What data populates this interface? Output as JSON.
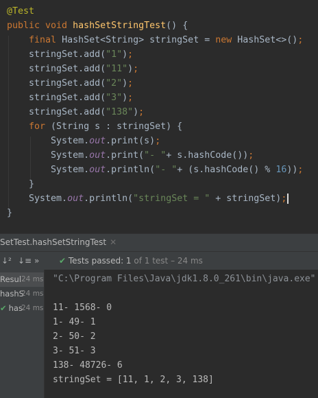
{
  "editor": {
    "lines": [
      {
        "segments": [
          {
            "t": "@Test",
            "c": "ann"
          }
        ]
      },
      {
        "segments": [
          {
            "t": "public void ",
            "c": "kw"
          },
          {
            "t": "hashSetStringTest",
            "c": "fn"
          },
          {
            "t": "() {",
            "c": ""
          }
        ]
      },
      {
        "segments": [
          {
            "t": "    final ",
            "c": "kw"
          },
          {
            "t": "HashSet<String> stringSet = ",
            "c": ""
          },
          {
            "t": "new ",
            "c": "kw"
          },
          {
            "t": "HashSet<>()",
            "c": ""
          },
          {
            "t": ";",
            "c": "kw"
          }
        ]
      },
      {
        "segments": [
          {
            "t": "    stringSet.add(",
            "c": ""
          },
          {
            "t": "\"1\"",
            "c": "str"
          },
          {
            "t": ")",
            "c": ""
          },
          {
            "t": ";",
            "c": "kw"
          }
        ]
      },
      {
        "segments": [
          {
            "t": "    stringSet.add(",
            "c": ""
          },
          {
            "t": "\"11\"",
            "c": "str"
          },
          {
            "t": ")",
            "c": ""
          },
          {
            "t": ";",
            "c": "kw"
          }
        ]
      },
      {
        "segments": [
          {
            "t": "    stringSet.add(",
            "c": ""
          },
          {
            "t": "\"2\"",
            "c": "str"
          },
          {
            "t": ")",
            "c": ""
          },
          {
            "t": ";",
            "c": "kw"
          }
        ]
      },
      {
        "segments": [
          {
            "t": "    stringSet.add(",
            "c": ""
          },
          {
            "t": "\"3\"",
            "c": "str"
          },
          {
            "t": ")",
            "c": ""
          },
          {
            "t": ";",
            "c": "kw"
          }
        ]
      },
      {
        "segments": [
          {
            "t": "    stringSet.add(",
            "c": ""
          },
          {
            "t": "\"138\"",
            "c": "str"
          },
          {
            "t": ")",
            "c": ""
          },
          {
            "t": ";",
            "c": "kw"
          }
        ]
      },
      {
        "segments": [
          {
            "t": "    for ",
            "c": "kw"
          },
          {
            "t": "(String s : stringSet) {",
            "c": ""
          }
        ]
      },
      {
        "segments": [
          {
            "t": "        System.",
            "c": ""
          },
          {
            "t": "out",
            "c": "fld"
          },
          {
            "t": ".print(s)",
            "c": ""
          },
          {
            "t": ";",
            "c": "kw"
          }
        ]
      },
      {
        "segments": [
          {
            "t": "        System.",
            "c": ""
          },
          {
            "t": "out",
            "c": "fld"
          },
          {
            "t": ".print(",
            "c": ""
          },
          {
            "t": "\"- \"",
            "c": "str"
          },
          {
            "t": "+ s.hashCode())",
            "c": ""
          },
          {
            "t": ";",
            "c": "kw"
          }
        ]
      },
      {
        "segments": [
          {
            "t": "        System.",
            "c": ""
          },
          {
            "t": "out",
            "c": "fld"
          },
          {
            "t": ".println(",
            "c": ""
          },
          {
            "t": "\"- \"",
            "c": "str"
          },
          {
            "t": "+ (s.hashCode() % ",
            "c": ""
          },
          {
            "t": "16",
            "c": "num"
          },
          {
            "t": "))",
            "c": ""
          },
          {
            "t": ";",
            "c": "kw"
          }
        ]
      },
      {
        "segments": [
          {
            "t": "    }",
            "c": ""
          }
        ]
      },
      {
        "segments": [
          {
            "t": "    System.",
            "c": ""
          },
          {
            "t": "out",
            "c": "fld"
          },
          {
            "t": ".println(",
            "c": ""
          },
          {
            "t": "\"stringSet = \"",
            "c": "str"
          },
          {
            "t": " + stringSet)",
            "c": ""
          },
          {
            "t": ";",
            "c": "kw"
          }
        ],
        "cursor": true
      },
      {
        "segments": [
          {
            "t": "}",
            "c": ""
          }
        ]
      }
    ]
  },
  "run_tab": {
    "title": "SetTest.hashSetStringTest",
    "close_glyph": "✕"
  },
  "toolbar": {
    "sort_alpha_icon": "↓²",
    "sort_duration_icon": "↓≡",
    "more_icon": "»",
    "status_prefix": "Tests passed: ",
    "passed": "1",
    "status_suffix": " of 1 test – 24 ms"
  },
  "test_tree": [
    {
      "label": "Resul",
      "time": "24 ms",
      "selected": true
    },
    {
      "label": "hashS",
      "time": "24 ms",
      "selected": false
    },
    {
      "label": "has",
      "time": "24 ms",
      "selected": false,
      "check": "✔"
    }
  ],
  "console": {
    "lines": [
      {
        "text": "\"C:\\Program Files\\Java\\jdk1.8.0_261\\bin\\java.exe\" ...",
        "cmd": true
      },
      {
        "text": ""
      },
      {
        "text": "11- 1568- 0"
      },
      {
        "text": "1- 49- 1"
      },
      {
        "text": "2- 50- 2"
      },
      {
        "text": "3- 51- 3"
      },
      {
        "text": "138- 48726- 6"
      },
      {
        "text": "stringSet = [11, 1, 2, 3, 138]"
      }
    ]
  },
  "colors": {
    "editor_bg": "#2b2b2b",
    "panel_bg": "#3c3f41",
    "keyword": "#cc7832",
    "annotation": "#bbb529",
    "method": "#ffc66d",
    "string": "#6a8759",
    "number": "#6897bb",
    "field": "#9876aa",
    "pass_green": "#59a869"
  }
}
